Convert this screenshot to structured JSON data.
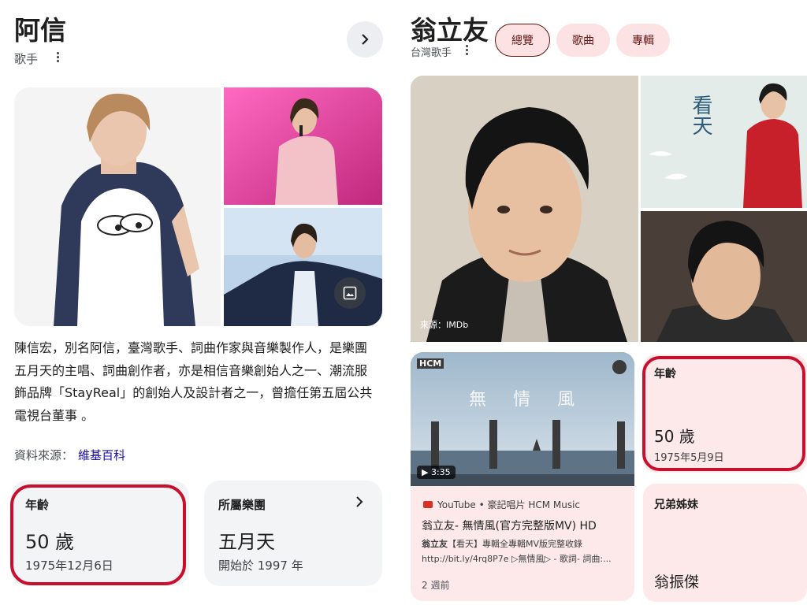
{
  "left": {
    "title": "阿信",
    "subtitle": "歌手",
    "description": "陳信宏，別名阿信，臺灣歌手、詞曲作家與音樂製作人，是樂團五月天的主唱、詞曲創作者，亦是相信音樂創始人之一、潮流服飾品牌「StayReal」的創始人及設計者之一，曾擔任第五屆公共電視台董事 。",
    "source_label": "資料來源：",
    "source_link": "維基百科",
    "age_card": {
      "label": "年齡",
      "value": "50 歲",
      "sub": "1975年12月6日"
    },
    "band_card": {
      "label": "所屬樂團",
      "value": "五月天",
      "sub": "開始於 1997 年"
    }
  },
  "right": {
    "title": "翁立友",
    "subtitle": "台灣歌手",
    "chips": [
      "總覽",
      "歌曲",
      "專輯"
    ],
    "image_credit": "來源：IMDb",
    "album_title": "看天",
    "video": {
      "channel_logo": "HCM",
      "overlay_title": "無　情　風",
      "duration": "▶ 3:35",
      "source": "YouTube • 豪記唱片 HCM Music",
      "title": "翁立友- 無情風(官方完整版MV) HD",
      "desc_line1_bold": "翁立友",
      "desc_line1": "【看天】專輯全專輯MV版完整收錄",
      "desc_line2": "http://bit.ly/4rq8P7e ▷無情風▷ - 歌詞- 詞曲:...",
      "time": "2 週前"
    },
    "age_card": {
      "label": "年齡",
      "value": "50 歲",
      "sub": "1975年5月9日"
    },
    "sibling_card": {
      "label": "兄弟姊妹",
      "value": "翁振傑"
    }
  },
  "colors": {
    "highlight": "#c8102e",
    "chip_bg": "#fde2e4",
    "chip_text": "#601410",
    "link": "#1a0dab"
  }
}
